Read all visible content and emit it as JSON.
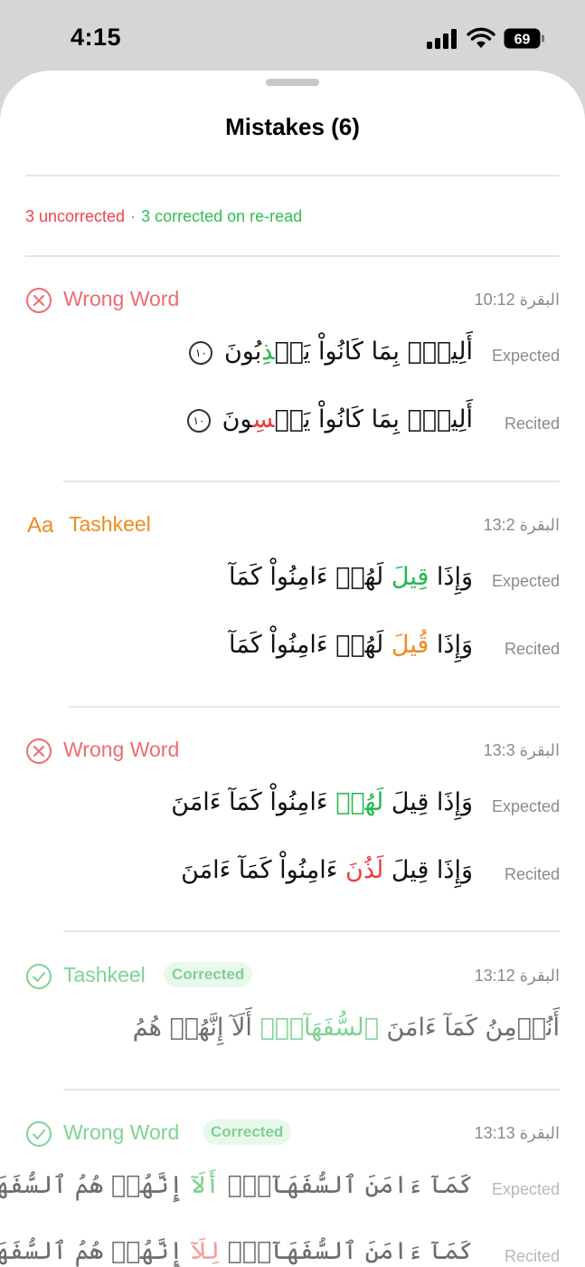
{
  "status_bar": {
    "time": "4:15",
    "battery": "69",
    "icons": [
      "cellular-signal-icon",
      "wifi-icon",
      "battery-icon"
    ]
  },
  "sheet": {
    "title": "Mistakes (6)",
    "summary": {
      "uncorrected": "3 uncorrected",
      "separator": "·",
      "corrected": "3 corrected on re-read"
    }
  },
  "colors": {
    "error_red": "#f0434a",
    "success_green": "#2fbf4f",
    "tashkeel_orange": "#f08a20",
    "faded_green": "#7ed394"
  },
  "labels": {
    "expected": "Expected",
    "recited": "Recited"
  },
  "mistakes": [
    {
      "type": "Wrong Word",
      "icon": "x-circle-icon",
      "ref": "البقرة 10:12",
      "expected": {
        "before": "أَلِيمُۢ بِمَا كَانُواْ يَكۡ",
        "mark": "ذِ",
        "after": "بُونَ",
        "ayah": "١٠"
      },
      "recited": {
        "before": "أَلِيمُۢ بِمَا كَانُواْ يَكۡ",
        "mark": "سِ",
        "after": "ونَ",
        "ayah": "١٠"
      }
    },
    {
      "type": "Tashkeel",
      "icon": "text-format-icon",
      "icon_glyph": "Aa",
      "ref": "البقرة 13:2",
      "expected": {
        "before": "وَإِذَا ",
        "mark": "قِيلَ",
        "after": " لَهُمۡ ءَامِنُواْ كَمَآ"
      },
      "recited": {
        "before": "وَإِذَا ",
        "mark": "قُيلَ",
        "after": " لَهُمۡ ءَامِنُواْ كَمَآ"
      }
    },
    {
      "type": "Wrong Word",
      "icon": "x-circle-icon",
      "ref": "البقرة 13:3",
      "expected": {
        "before": "وَإِذَا قِيلَ ",
        "mark": "لَهُمۡ",
        "after": " ءَامِنُواْ كَمَآ ءَامَنَ"
      },
      "recited": {
        "before": "وَإِذَا قِيلَ ",
        "mark": "لَذُنَ",
        "after": " ءَامِنُواْ كَمَآ ءَامَنَ"
      }
    },
    {
      "type": "Tashkeel",
      "icon": "check-circle-icon",
      "badge": "Corrected",
      "ref": "البقرة 13:12",
      "text": {
        "before": "أَنُؤۡمِنُ كَمَآ ءَامَنَ ",
        "mark": "ٱلسُّفَهَآءُۗ",
        "after": " أَلَآ إِنَّهُمۡ هُمُ"
      }
    },
    {
      "type": "Wrong Word",
      "icon": "check-circle-icon",
      "badge": "Corrected",
      "ref": "البقرة 13:13",
      "expected": {
        "before": "كَمَآ ءَامَنَ ٱلسُّفَهَآءُۗ ",
        "mark": "أَلَآ",
        "after": " إِنَّهُمۡ هُمُ ٱلسُّفَهَآءُ"
      },
      "recited": {
        "before": "كَمَآ ءَامَنَ ٱلسُّفَهَآءُۗ ",
        "mark": "لِلَآ",
        "after": " إِنَّهُمۡ هُمُ ٱلسُّفَهَآءُ"
      }
    }
  ]
}
